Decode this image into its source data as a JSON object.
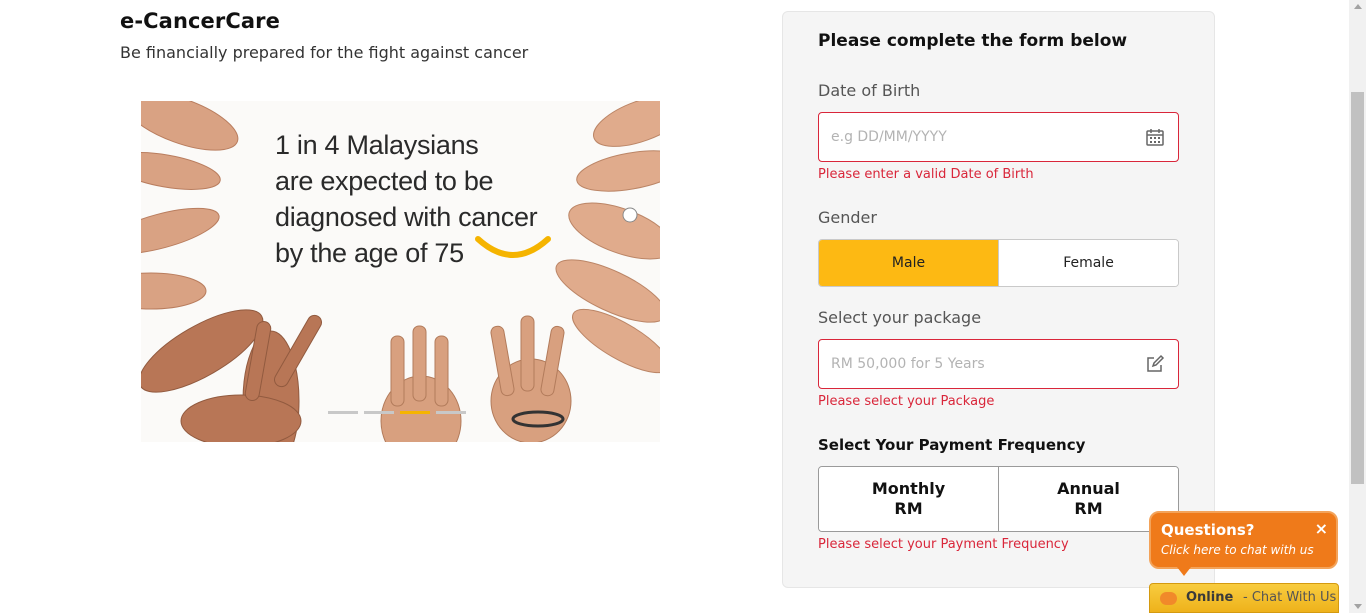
{
  "product": {
    "title": "e-CancerCare",
    "subtitle": "Be financially prepared for the fight against cancer"
  },
  "banner": {
    "lines": [
      "1 in 4 Malaysians",
      "are expected to be",
      "diagnosed with cancer",
      "by the age of 75"
    ],
    "carousel_slides": 4,
    "active_slide_index": 2,
    "accent_color": "#f5b400"
  },
  "form": {
    "heading": "Please complete the form below",
    "dob": {
      "label": "Date of Birth",
      "placeholder": "e.g DD/MM/YYYY",
      "icon": "calendar-icon",
      "error": "Please enter a valid Date of Birth"
    },
    "gender": {
      "label": "Gender",
      "options": [
        "Male",
        "Female"
      ],
      "selected": "Male",
      "selected_color": "#fdb913"
    },
    "package": {
      "label": "Select your package",
      "placeholder": "RM 50,000 for 5 Years",
      "icon": "edit-icon",
      "error": "Please select your Package"
    },
    "payment_frequency": {
      "heading": "Select Your Payment Frequency",
      "options": [
        {
          "line1": "Monthly",
          "line2": "RM"
        },
        {
          "line1": "Annual",
          "line2": "RM"
        }
      ],
      "error": "Please select your Payment Frequency"
    },
    "error_color": "#d9263a"
  },
  "chat": {
    "bubble_title": "Questions?",
    "bubble_subtitle": "Click here to chat with us",
    "close_glyph": "×",
    "status": "Online",
    "separator": "-",
    "cta": "Chat With Us",
    "color": "#ef7a1a"
  }
}
